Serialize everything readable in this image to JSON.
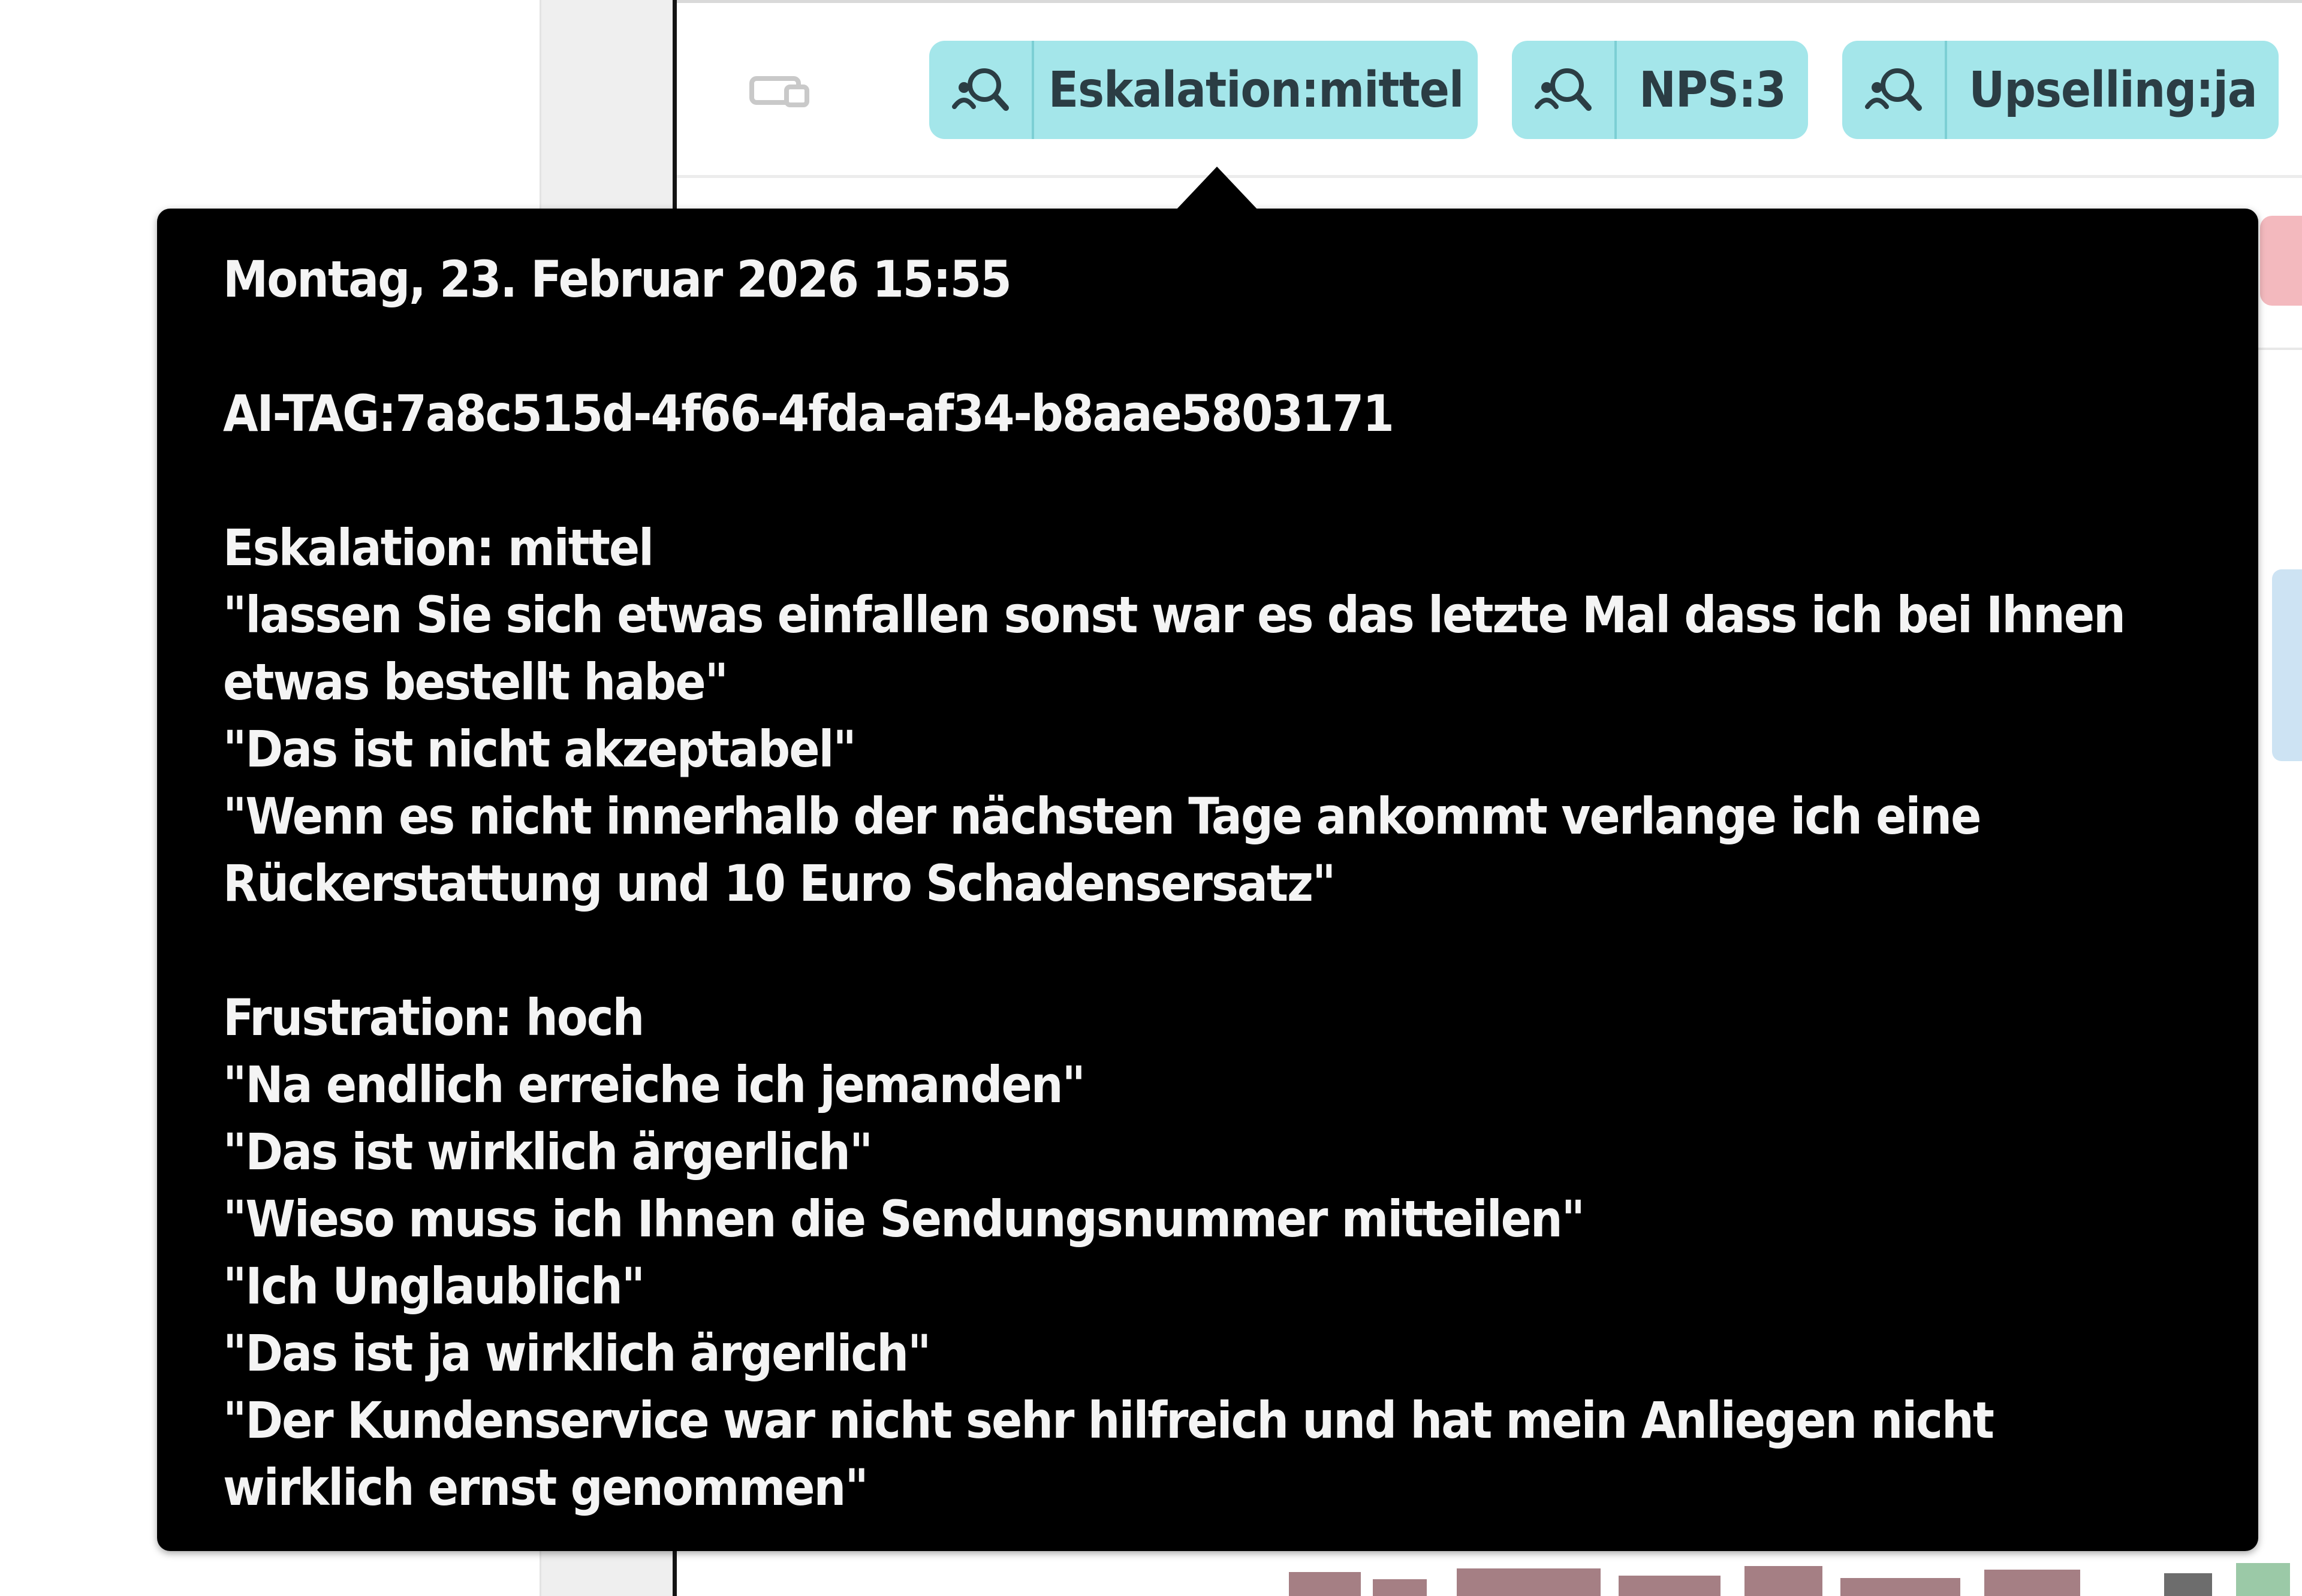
{
  "tag_bar": {
    "chips": [
      {
        "icon": "search-person-icon",
        "label": "Eskalation:mittel"
      },
      {
        "icon": "search-person-icon",
        "label": "NPS:3"
      },
      {
        "icon": "search-person-icon",
        "label": "Upselling:ja"
      }
    ],
    "chip_color": "#a4e6ea"
  },
  "tooltip": {
    "datetime": "Montag, 23. Februar 2026 15:55",
    "ai_tag": "AI-TAG:7a8c515d-4f66-4fda-af34-b8aae5803171",
    "eskalation": {
      "heading": "Eskalation: mittel",
      "lines": [
        "\"lassen Sie sich etwas einfallen sonst war es das letzte Mal dass ich bei Ihnen",
        "etwas bestellt habe\"",
        "\"Das ist nicht akzeptabel\"",
        "\"Wenn es nicht innerhalb der nächsten Tage ankommt verlange ich eine",
        "Rückerstattung und 10 Euro Schadensersatz\""
      ]
    },
    "frustration": {
      "heading": "Frustration: hoch",
      "lines": [
        "\"Na endlich erreiche ich jemanden\"",
        "\"Das ist wirklich ärgerlich\"",
        "\"Wieso muss ich Ihnen die Sendungsnummer mitteilen\"",
        "\"Ich Unglaublich\"",
        "\"Das ist ja wirklich ärgerlich\"",
        "\"Der Kundenservice war nicht sehr hilfreich und hat mein Anliegen nicht",
        "wirklich ernst genommen\""
      ]
    }
  }
}
